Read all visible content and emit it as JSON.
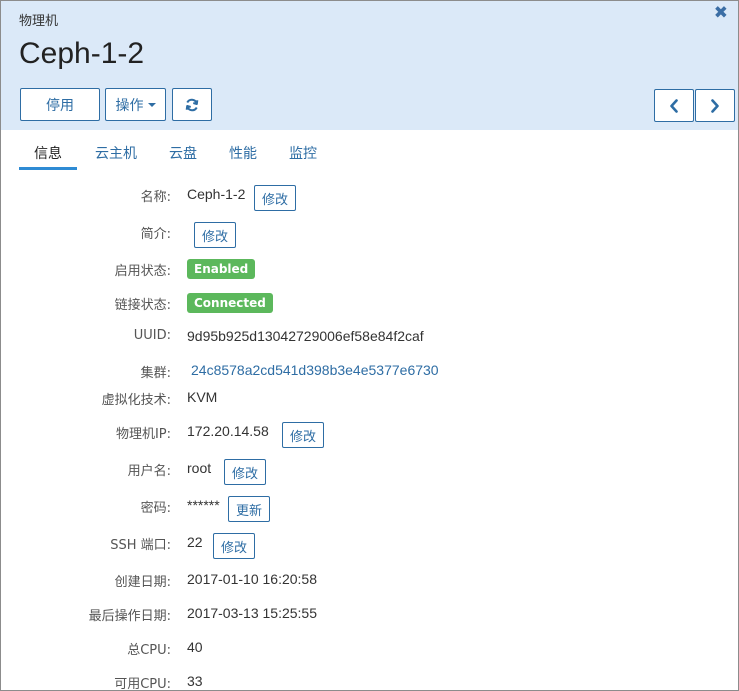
{
  "header": {
    "breadcrumb": "物理机",
    "title": "Ceph-1-2",
    "close_icon": "✖"
  },
  "toolbar": {
    "stop_label": "停用",
    "ops_label": "操作",
    "refresh_icon": "refresh-icon",
    "prev_icon": "chevron-left-icon",
    "next_icon": "chevron-right-icon"
  },
  "tabs": [
    {
      "label": "信息",
      "active": true
    },
    {
      "label": "云主机",
      "active": false
    },
    {
      "label": "云盘",
      "active": false
    },
    {
      "label": "性能",
      "active": false
    },
    {
      "label": "监控",
      "active": false
    }
  ],
  "details": {
    "name": {
      "label": "名称:",
      "value": "Ceph-1-2",
      "action": "修改"
    },
    "description": {
      "label": "简介:",
      "value": "",
      "action": "修改"
    },
    "enable_state": {
      "label": "启用状态:",
      "badge": "Enabled"
    },
    "connection_state": {
      "label": "链接状态:",
      "badge": "Connected"
    },
    "uuid": {
      "label": "UUID:",
      "value": "9d95b925d13042729006ef58e84f2caf"
    },
    "cluster": {
      "label": "集群:",
      "value": "24c8578a2cd541d398b3e4e5377e6730"
    },
    "virtualization": {
      "label": "虚拟化技术:",
      "value": "KVM"
    },
    "host_ip": {
      "label": "物理机IP:",
      "value": "172.20.14.58",
      "action": "修改"
    },
    "username": {
      "label": "用户名:",
      "value": "root",
      "action": "修改"
    },
    "password": {
      "label": "密码:",
      "value": "******",
      "action": "更新"
    },
    "ssh_port": {
      "label": "SSH 端口:",
      "value": "22",
      "action": "修改"
    },
    "created": {
      "label": "创建日期:",
      "value": "2017-01-10 16:20:58"
    },
    "last_op": {
      "label": "最后操作日期:",
      "value": "2017-03-13 15:25:55"
    },
    "total_cpu": {
      "label": "总CPU:",
      "value": "40"
    },
    "available_cpu": {
      "label": "可用CPU:",
      "value": "33"
    }
  },
  "colors": {
    "header_bg": "#dbe9f8",
    "accent": "#2e6da4",
    "badge_green": "#5cb85c",
    "tab_underline": "#2e8bd4"
  }
}
